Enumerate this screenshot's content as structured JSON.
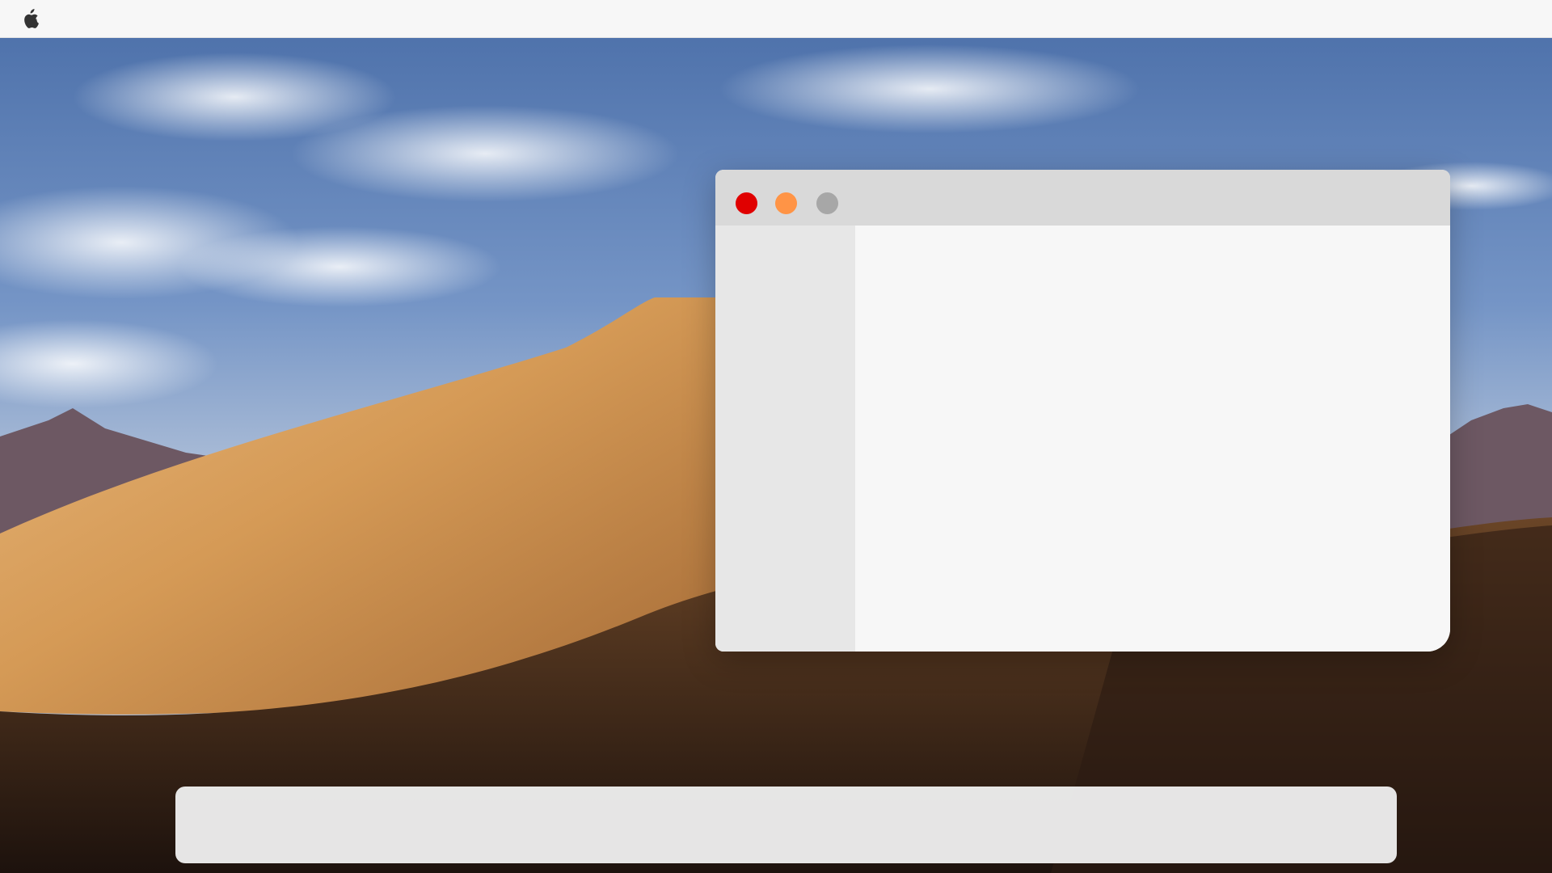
{
  "desktop": {
    "wallpaper": "desert-dunes-wallpaper"
  },
  "menubar": {
    "logo_icon": "apple-logo-icon"
  },
  "window": {
    "traffic_lights": {
      "close": {
        "icon": "close-dot-icon",
        "color": "#e00000"
      },
      "minimize": {
        "icon": "minimize-dot-icon",
        "color": "#ff9446"
      },
      "zoom": {
        "icon": "zoom-dot-icon",
        "color": "#a7a7a7"
      }
    },
    "colors": {
      "titlebar": "#d9d9d9",
      "sidebar": "#e7e7e7",
      "content": "#f7f7f7"
    }
  },
  "dock": {
    "items": []
  }
}
